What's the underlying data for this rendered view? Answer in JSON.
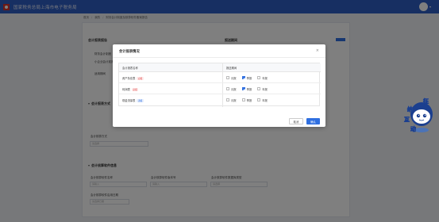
{
  "header": {
    "title": "国家税务总局上海市电子税务局"
  },
  "breadcrumb": [
    "首页",
    "我的",
    "财务会计制度及核算软件备案报告"
  ],
  "background": {
    "section1_title": "会计报表报告",
    "section1_right_title": "报送期间",
    "section2_title": "会计报表方式",
    "section3_title": "会计核算软件信息",
    "labels": [
      "财务会计制度",
      "小企业会计准则",
      "适用期间",
      "会计核算方式",
      "会计核算软件名称",
      "会计核算软件版本号",
      "会计核算软件数据库类型",
      "会计核算软件启用日期"
    ],
    "placeholders": [
      "请选择",
      "请输入",
      "请选择",
      "请选择日期"
    ]
  },
  "modal": {
    "title": "会计报表情况",
    "close": "×",
    "col_name": "会计报表名称",
    "col_period": "报送期间",
    "rows": [
      {
        "name": "资产负债表",
        "tag": "必报",
        "tag_color": "#e04848",
        "tag_bg": "#fdeaea",
        "checked": "季报"
      },
      {
        "name": "利润表",
        "tag": "必报",
        "tag_color": "#e04848",
        "tag_bg": "#fdeaea",
        "checked": "季报"
      },
      {
        "name": "现金流量表",
        "tag": "选报",
        "tag_color": "#2f6fe0",
        "tag_bg": "#e6eefc",
        "checked": ""
      }
    ],
    "options": [
      "月报",
      "季报",
      "年报"
    ],
    "cancel": "取消",
    "confirm": "确认"
  },
  "mascot": {
    "lines": [
      "征",
      "纳",
      "互",
      "动"
    ]
  },
  "colors": {
    "primary": "#2f6fe0",
    "header": "#2f5ec4",
    "required": "#e04848"
  }
}
